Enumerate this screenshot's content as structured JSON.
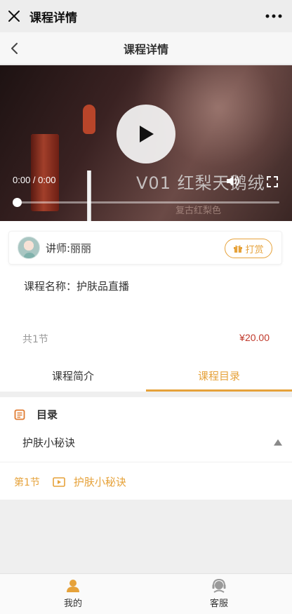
{
  "wechat_bar": {
    "title": "课程详情"
  },
  "header": {
    "title": "课程详情"
  },
  "video": {
    "time": "0:00 / 0:00",
    "overlay_text": "V01 红梨天鹅绒",
    "overlay_sub": "复古红梨色",
    "progress": 0
  },
  "teacher": {
    "name": "讲师:丽丽",
    "reward_label": "打赏"
  },
  "course": {
    "name": "课程名称：护肤品直播",
    "lesson_count": "共1节",
    "price": "¥20.00"
  },
  "tabs": [
    {
      "label": "课程简介",
      "active": false
    },
    {
      "label": "课程目录",
      "active": true
    }
  ],
  "catalog": {
    "title": "目录",
    "chapter": "护肤小秘诀",
    "lessons": [
      {
        "num": "第1节",
        "name": "护肤小秘诀"
      }
    ]
  },
  "bottom_nav": [
    {
      "label": "我的",
      "icon": "user-icon"
    },
    {
      "label": "客服",
      "icon": "customer-service-icon"
    }
  ],
  "colors": {
    "accent": "#e6a23a",
    "price": "#c0392b"
  }
}
